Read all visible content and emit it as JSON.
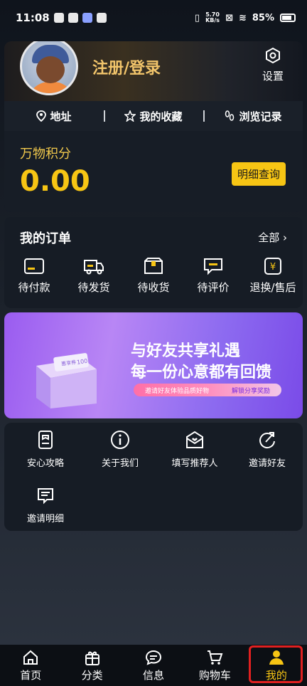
{
  "statusbar": {
    "time": "11:08",
    "netspeed_value": "5.70",
    "netspeed_unit": "KB/s",
    "battery": "85%"
  },
  "profile": {
    "login_label": "注册/登录",
    "settings_label": "设置",
    "quicklinks": [
      {
        "label": "地址",
        "icon": "location-icon"
      },
      {
        "label": "我的收藏",
        "icon": "star-icon"
      },
      {
        "label": "浏览记录",
        "icon": "footprint-icon"
      }
    ],
    "points_label": "万物积分",
    "points_value": "0.00",
    "detail_button": "明细查询"
  },
  "orders": {
    "title": "我的订单",
    "all_label": "全部",
    "items": [
      {
        "label": "待付款",
        "icon": "wallet-icon"
      },
      {
        "label": "待发货",
        "icon": "truck-icon"
      },
      {
        "label": "待收货",
        "icon": "box-icon"
      },
      {
        "label": "待评价",
        "icon": "comment-icon"
      },
      {
        "label": "退换/售后",
        "icon": "refund-icon"
      }
    ]
  },
  "banner": {
    "title_line1": "与好友共享礼遇",
    "title_line2": "每一份心意都有回馈",
    "pill_left": "邀请好友体验品质好物",
    "pill_right": "解锁分享奖励",
    "coupon_text": "惠享券",
    "coupon_value": "100"
  },
  "tools": [
    {
      "label": "安心攻略",
      "icon": "guide-icon"
    },
    {
      "label": "关于我们",
      "icon": "info-icon"
    },
    {
      "label": "填写推荐人",
      "icon": "envelope-heart-icon"
    },
    {
      "label": "邀请好友",
      "icon": "share-icon"
    },
    {
      "label": "邀请明细",
      "icon": "list-message-icon"
    }
  ],
  "tabbar": [
    {
      "label": "首页",
      "icon": "home-icon"
    },
    {
      "label": "分类",
      "icon": "gift-icon"
    },
    {
      "label": "信息",
      "icon": "chat-icon"
    },
    {
      "label": "购物车",
      "icon": "cart-icon"
    },
    {
      "label": "我的",
      "icon": "user-icon"
    }
  ],
  "colors": {
    "accent": "#f7c514",
    "login": "#f2c56b",
    "highlight": "#e02020"
  }
}
